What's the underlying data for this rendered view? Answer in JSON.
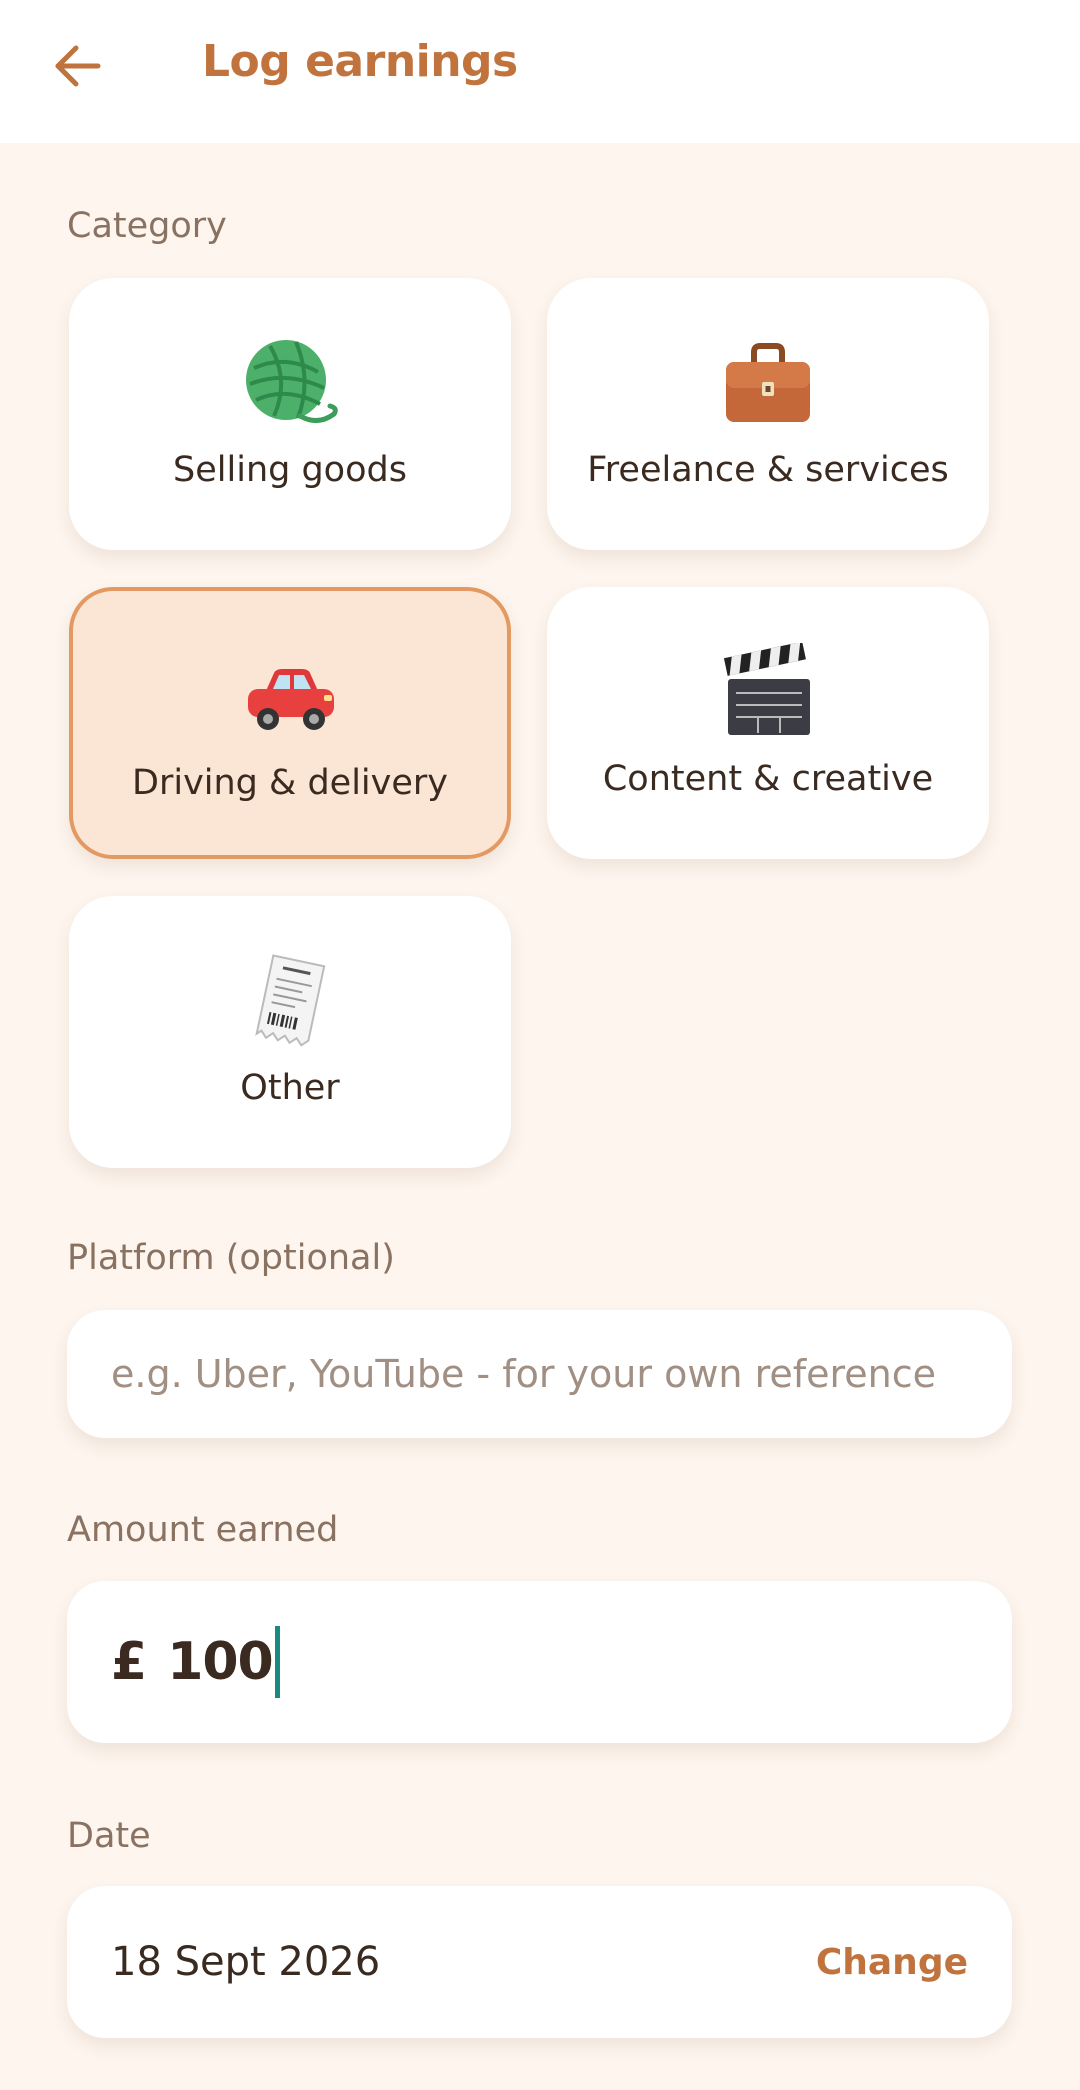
{
  "header": {
    "title": "Log earnings",
    "back_icon": "arrow-left-icon"
  },
  "colors": {
    "accent": "#c0733d",
    "background": "#fdf5ee",
    "selected_card_bg": "#fbe6d6",
    "selected_card_border": "#e39a62",
    "caret": "#1a8a80"
  },
  "category": {
    "label": "Category",
    "selected": "Driving & delivery",
    "items": [
      {
        "label": "Selling goods",
        "icon": "yarn-ball-icon",
        "selected": false
      },
      {
        "label": "Freelance & services",
        "icon": "briefcase-icon",
        "selected": false
      },
      {
        "label": "Driving & delivery",
        "icon": "car-icon",
        "selected": true
      },
      {
        "label": "Content & creative",
        "icon": "clapper-board-icon",
        "selected": false
      },
      {
        "label": "Other",
        "icon": "receipt-icon",
        "selected": false
      }
    ]
  },
  "platform": {
    "label": "Platform (optional)",
    "placeholder": "e.g. Uber, YouTube - for your own reference",
    "value": ""
  },
  "amount": {
    "label": "Amount earned",
    "currency": "£",
    "value": "100"
  },
  "date": {
    "label": "Date",
    "value": "18 Sept 2026",
    "change_label": "Change"
  }
}
